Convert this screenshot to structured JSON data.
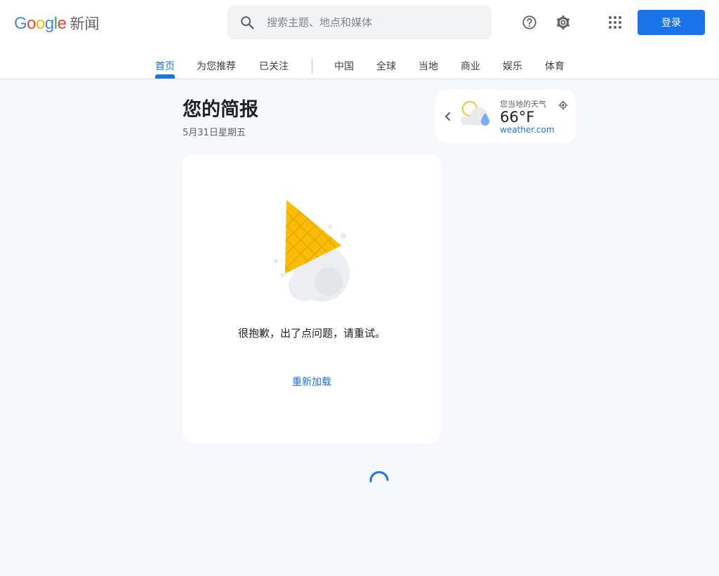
{
  "header": {
    "logo": {
      "letters": [
        {
          "ch": "G",
          "color": "#4285F4"
        },
        {
          "ch": "o",
          "color": "#EA4335"
        },
        {
          "ch": "o",
          "color": "#FBBC05"
        },
        {
          "ch": "g",
          "color": "#4285F4"
        },
        {
          "ch": "l",
          "color": "#34A853"
        },
        {
          "ch": "e",
          "color": "#EA4335"
        }
      ],
      "news_label": "新闻"
    },
    "search": {
      "placeholder": "搜索主题、地点和媒体",
      "value": "",
      "icon": "search-icon"
    },
    "help_icon": "help-circle-icon",
    "settings_icon": "gear-icon",
    "apps_icon": "apps-grid-icon",
    "signin_label": "登录"
  },
  "tabs": [
    {
      "label": "首页",
      "active": true
    },
    {
      "label": "为您推荐"
    },
    {
      "label": "已关注"
    },
    {
      "label": "中国"
    },
    {
      "label": "全球"
    },
    {
      "label": "当地"
    },
    {
      "label": "商业"
    },
    {
      "label": "娱乐"
    },
    {
      "label": "体育"
    }
  ],
  "briefing": {
    "title": "您的简报",
    "date": "5月31日星期五"
  },
  "weather": {
    "label": "您当地的天气",
    "temperature": "66°F",
    "source": "weather.com",
    "condition_icon": "sun-rain-icon",
    "prev_icon": "chevron-left-icon",
    "location_icon": "my-location-icon"
  },
  "error_card": {
    "illustration": "dropped-ice-cream-icon",
    "message": "很抱歉，出了点问题，请重试。",
    "reload_label": "重新加载"
  },
  "colors": {
    "accent": "#1a73e8",
    "background": "#f6f8fc",
    "card": "#ffffff",
    "cone": "#fbbc05"
  }
}
